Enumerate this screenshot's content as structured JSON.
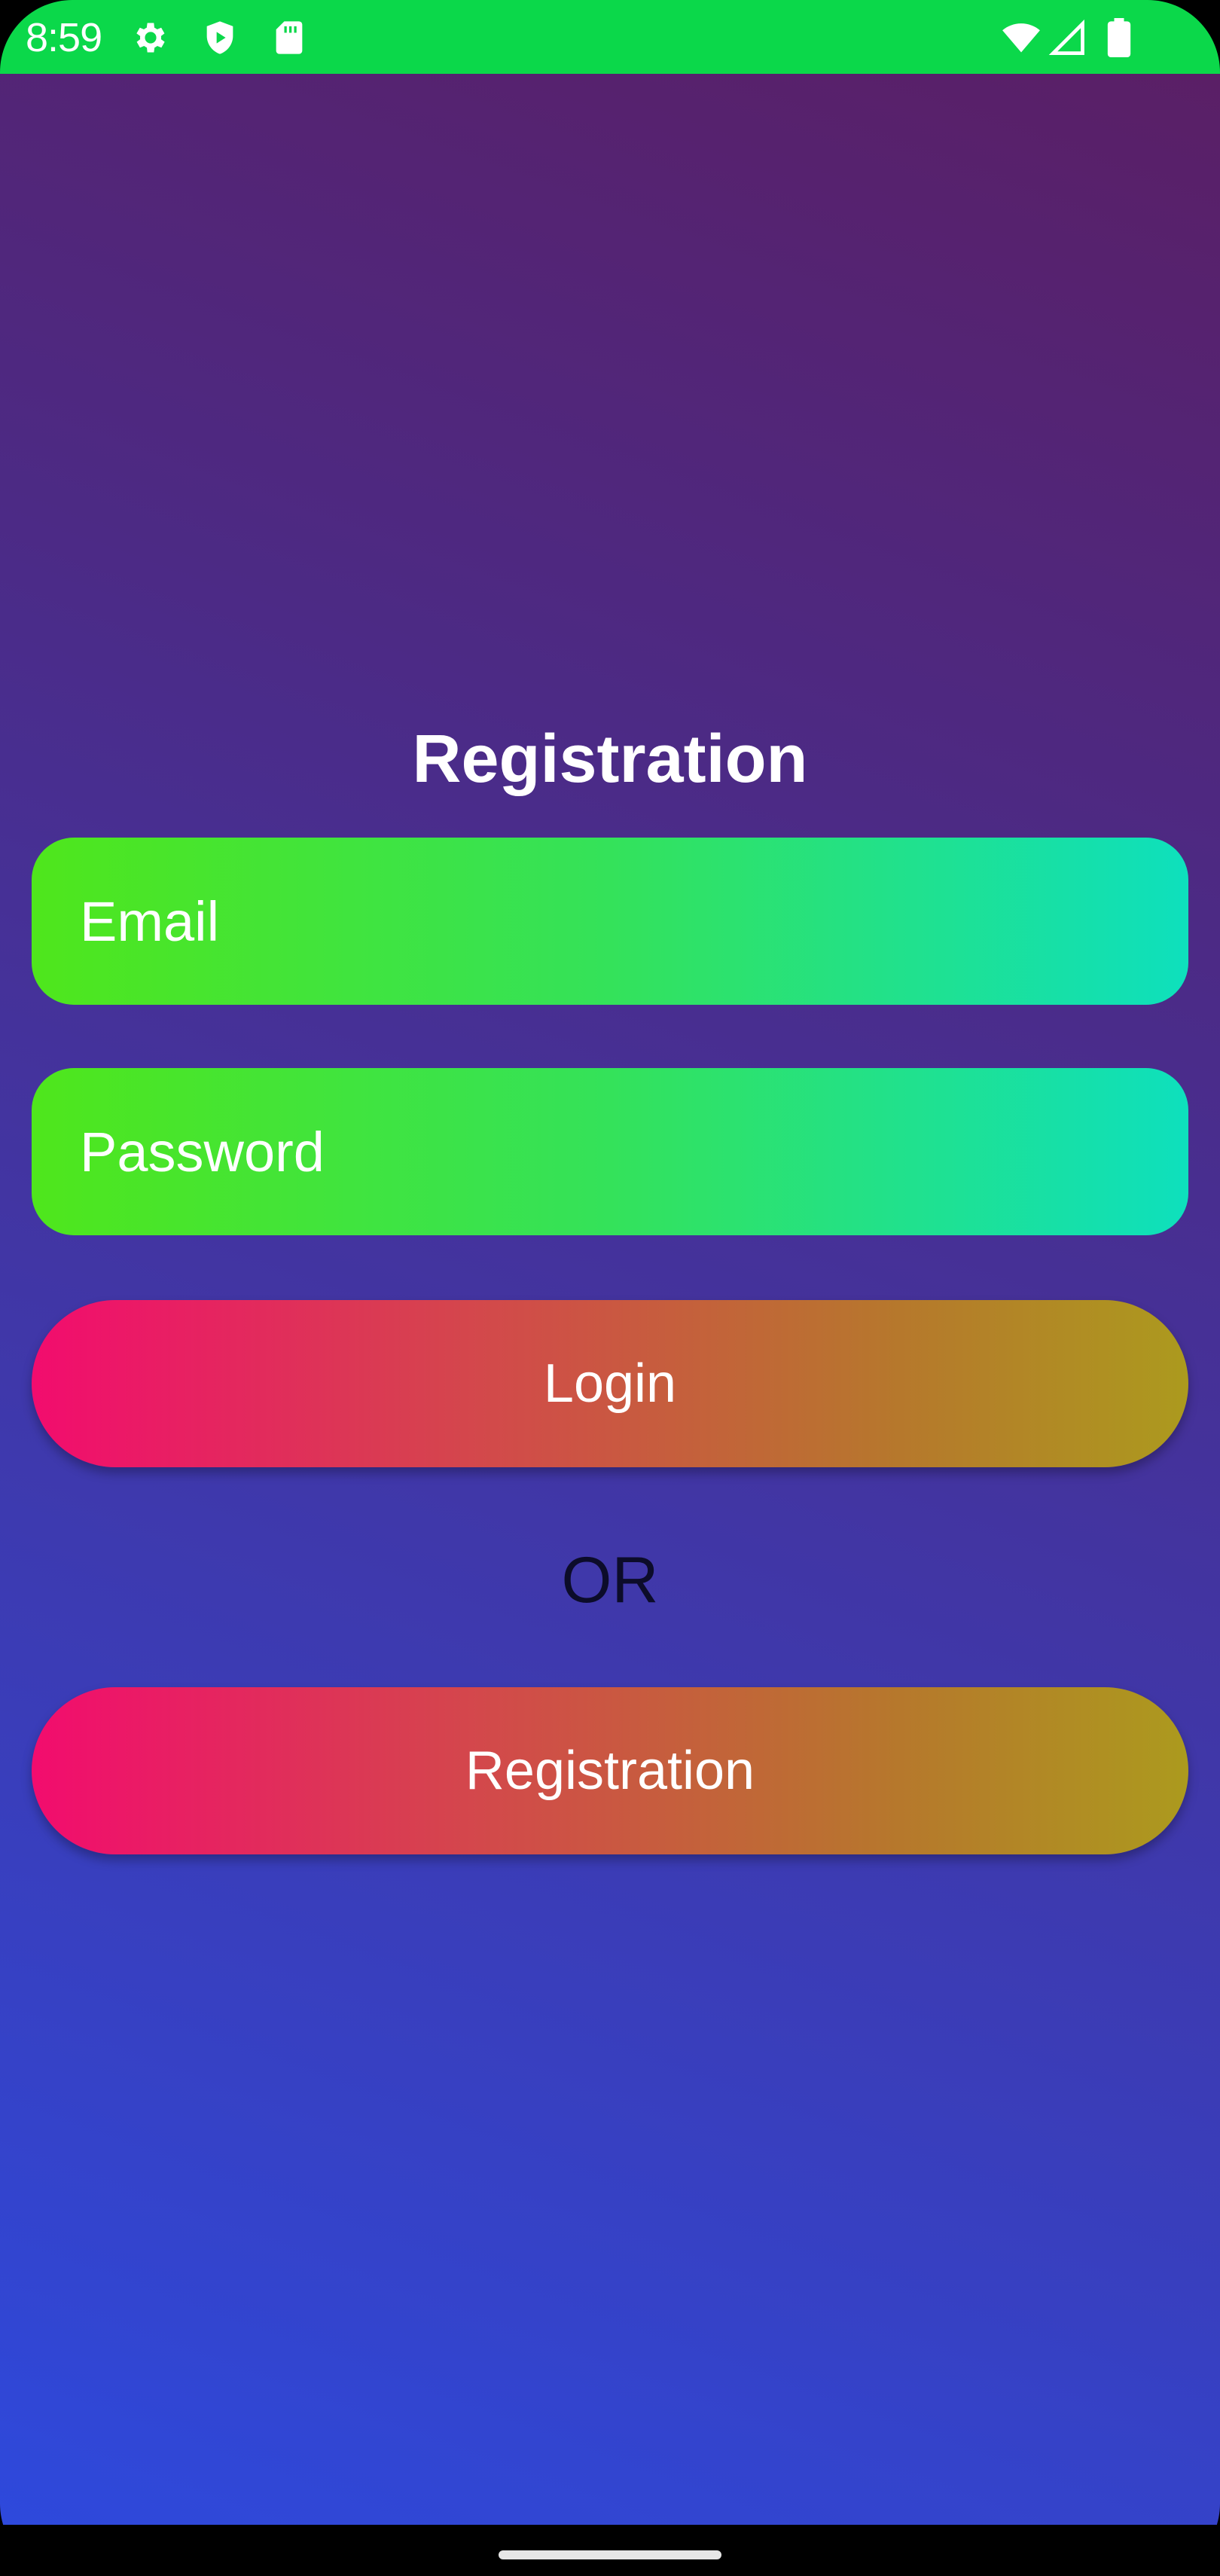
{
  "status_bar": {
    "time": "8:59",
    "background_color": "#0bd84a",
    "left_icons": [
      "gear-icon",
      "play-shield-icon",
      "sd-card-icon"
    ],
    "right_icons": [
      "wifi-icon",
      "cell-signal-icon",
      "battery-icon"
    ]
  },
  "screen": {
    "title": "Registration",
    "email_placeholder": "Email",
    "password_placeholder": "Password",
    "login_label": "Login",
    "or_text": "OR",
    "registration_label": "Registration"
  },
  "colors": {
    "background_top": "#5a1f66",
    "background_bottom": "#2e49dc",
    "field_gradient_start": "#4fe61c",
    "field_gradient_end": "#0ee0bd",
    "button_gradient_start": "#f20c6e",
    "button_gradient_end": "#ac9a1e",
    "or_text": "#0c0c2a"
  }
}
